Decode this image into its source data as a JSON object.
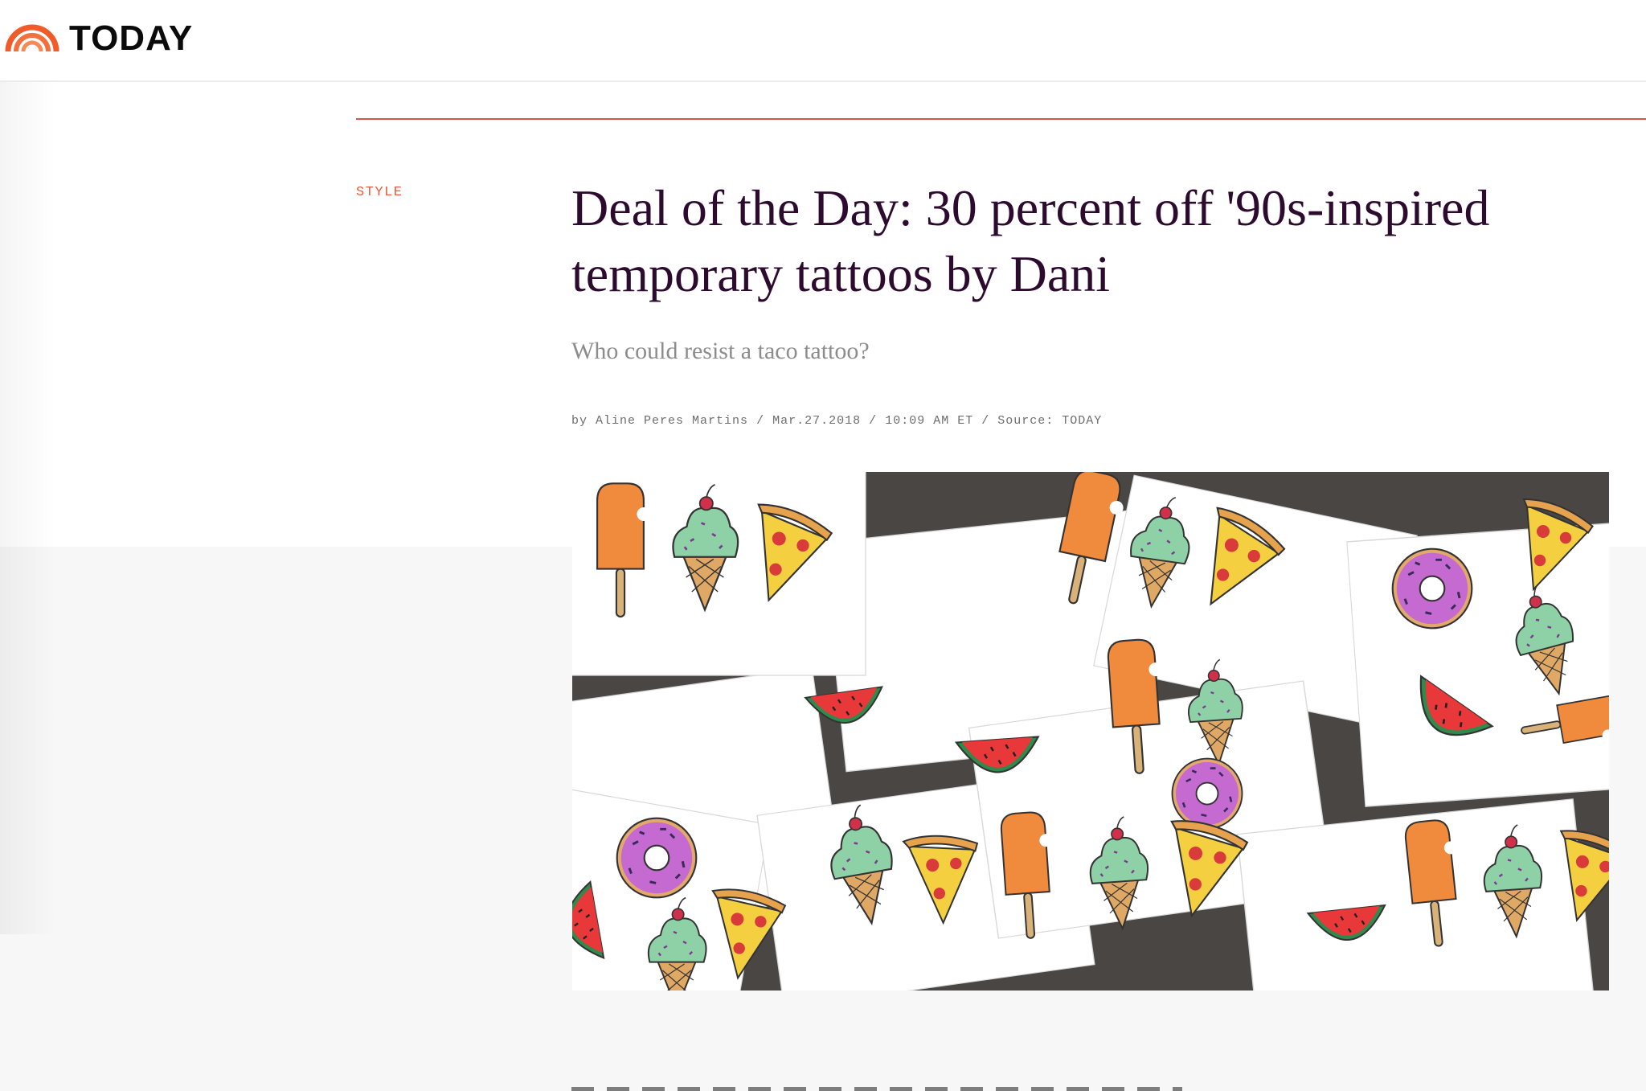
{
  "header": {
    "logo_text": "TODAY",
    "logo_icon": "rainbow-icon",
    "brand_color": "#f15a29"
  },
  "article": {
    "section": "STYLE",
    "headline_line1": "Deal of the Day: 30 percent off '90s-inspired",
    "headline_line2": "temporary tattoos by Dani",
    "dek": "Who could resist a taco tattoo?",
    "byline": {
      "prefix": "by",
      "author": "Aline Peres Martins",
      "sep": "/",
      "date": "Mar.27.2018",
      "time": "10:09 AM ET",
      "source": "Source: TODAY"
    }
  },
  "colors": {
    "accent_red": "#d9534a",
    "section_label": "#ea5b3e",
    "headline": "#2c0b2f",
    "dek": "#8c8c8c"
  },
  "hero_image": {
    "icons": [
      "popsicle-icon",
      "ice-cream-cone-icon",
      "pizza-slice-icon",
      "donut-icon",
      "watermelon-slice-icon"
    ]
  }
}
